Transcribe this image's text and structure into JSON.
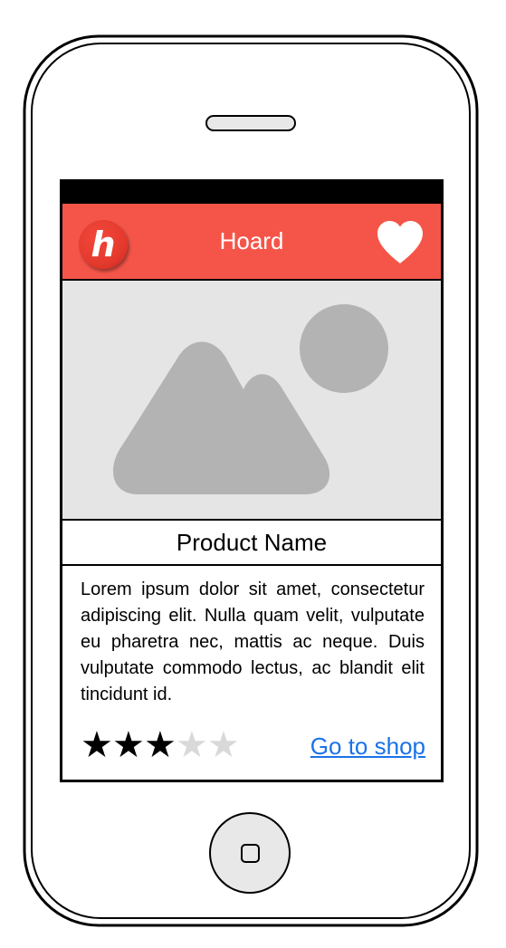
{
  "header": {
    "logo_letter": "h",
    "title": "Hoard",
    "background_color": "#f55549",
    "favorite_icon": "heart-icon"
  },
  "product": {
    "image_placeholder_icon": "image-placeholder-icon",
    "name": "Product Name",
    "description": "Lorem ipsum dolor sit amet, consectetur adipiscing elit. Nulla quam velit, vulputate eu pharetra nec, mattis ac neque. Duis vulputate commodo lectus, ac blandit elit tincidunt id.",
    "rating": {
      "value": 3,
      "max": 5,
      "filled_color": "#000000",
      "empty_color": "#d9d9d9"
    },
    "shop_link_label": "Go to shop",
    "link_color": "#1a73e8"
  }
}
